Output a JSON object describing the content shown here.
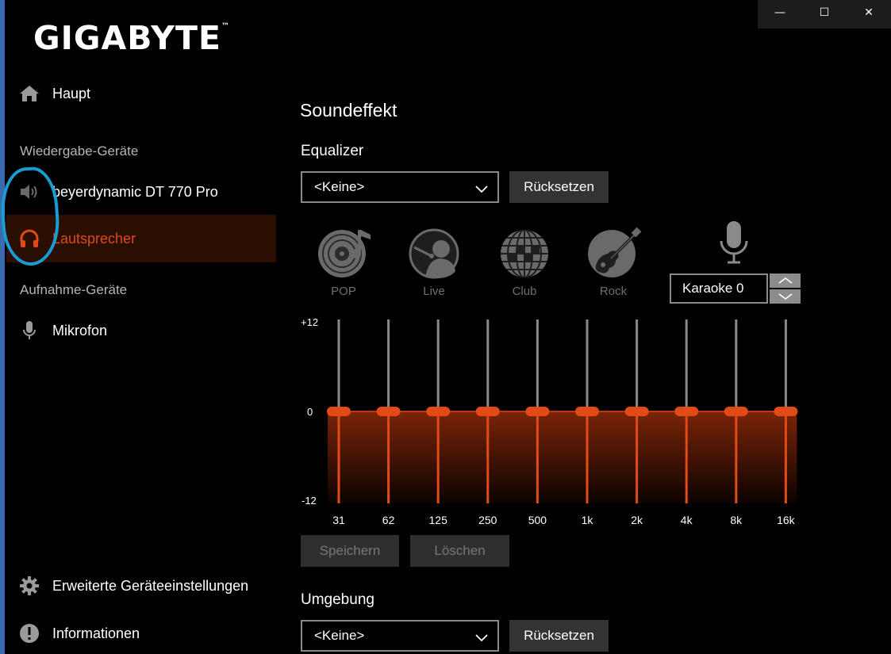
{
  "brand": {
    "logo_text": "GIGABYTE",
    "logo_mark": "™"
  },
  "window_controls": {
    "minimize": "—",
    "maximize": "☐",
    "close": "✕"
  },
  "sidebar": {
    "main_label": "Haupt",
    "playback_section": "Wiedergabe-Geräte",
    "playback_devices": [
      {
        "label": "beyerdynamic DT 770 Pro",
        "icon": "speaker-icon",
        "active": false
      },
      {
        "label": "Lautsprecher",
        "icon": "headphones-icon",
        "active": true
      }
    ],
    "recording_section": "Aufnahme-Geräte",
    "recording_devices": [
      {
        "label": "Mikrofon",
        "icon": "microphone-icon"
      }
    ],
    "advanced_label": "Erweiterte Geräteeinstellungen",
    "info_label": "Informationen"
  },
  "main": {
    "title": "Soundeffekt",
    "equalizer": {
      "label": "Equalizer",
      "preset_value": "<Keine>",
      "reset_label": "Rücksetzen",
      "presets": [
        "POP",
        "Live",
        "Club",
        "Rock"
      ],
      "karaoke_value": "Karaoke 0",
      "y_labels": {
        "max": "+12",
        "mid": "0",
        "min": "-12"
      },
      "bands": [
        "31",
        "62",
        "125",
        "250",
        "500",
        "1k",
        "2k",
        "4k",
        "8k",
        "16k"
      ],
      "gains_db": [
        0,
        0,
        0,
        0,
        0,
        0,
        0,
        0,
        0,
        0
      ],
      "save_label": "Speichern",
      "delete_label": "Löschen"
    },
    "environment": {
      "label": "Umgebung",
      "preset_value": "<Keine>",
      "reset_label": "Rücksetzen"
    }
  },
  "colors": {
    "accent": "#e24a16",
    "active_bg": "#2b0e02",
    "annotation": "#1a9cd2"
  }
}
